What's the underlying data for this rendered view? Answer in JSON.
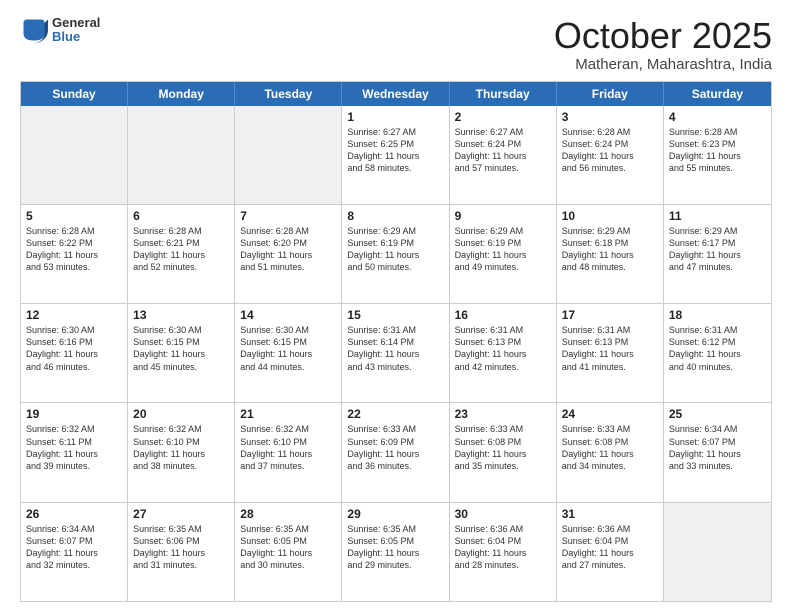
{
  "header": {
    "logo_general": "General",
    "logo_blue": "Blue",
    "month_title": "October 2025",
    "location": "Matheran, Maharashtra, India"
  },
  "weekdays": [
    "Sunday",
    "Monday",
    "Tuesday",
    "Wednesday",
    "Thursday",
    "Friday",
    "Saturday"
  ],
  "rows": [
    [
      {
        "day": "",
        "info": "",
        "shaded": true
      },
      {
        "day": "",
        "info": "",
        "shaded": true
      },
      {
        "day": "",
        "info": "",
        "shaded": true
      },
      {
        "day": "1",
        "info": "Sunrise: 6:27 AM\nSunset: 6:25 PM\nDaylight: 11 hours\nand 58 minutes."
      },
      {
        "day": "2",
        "info": "Sunrise: 6:27 AM\nSunset: 6:24 PM\nDaylight: 11 hours\nand 57 minutes."
      },
      {
        "day": "3",
        "info": "Sunrise: 6:28 AM\nSunset: 6:24 PM\nDaylight: 11 hours\nand 56 minutes."
      },
      {
        "day": "4",
        "info": "Sunrise: 6:28 AM\nSunset: 6:23 PM\nDaylight: 11 hours\nand 55 minutes."
      }
    ],
    [
      {
        "day": "5",
        "info": "Sunrise: 6:28 AM\nSunset: 6:22 PM\nDaylight: 11 hours\nand 53 minutes."
      },
      {
        "day": "6",
        "info": "Sunrise: 6:28 AM\nSunset: 6:21 PM\nDaylight: 11 hours\nand 52 minutes."
      },
      {
        "day": "7",
        "info": "Sunrise: 6:28 AM\nSunset: 6:20 PM\nDaylight: 11 hours\nand 51 minutes."
      },
      {
        "day": "8",
        "info": "Sunrise: 6:29 AM\nSunset: 6:19 PM\nDaylight: 11 hours\nand 50 minutes."
      },
      {
        "day": "9",
        "info": "Sunrise: 6:29 AM\nSunset: 6:19 PM\nDaylight: 11 hours\nand 49 minutes."
      },
      {
        "day": "10",
        "info": "Sunrise: 6:29 AM\nSunset: 6:18 PM\nDaylight: 11 hours\nand 48 minutes."
      },
      {
        "day": "11",
        "info": "Sunrise: 6:29 AM\nSunset: 6:17 PM\nDaylight: 11 hours\nand 47 minutes."
      }
    ],
    [
      {
        "day": "12",
        "info": "Sunrise: 6:30 AM\nSunset: 6:16 PM\nDaylight: 11 hours\nand 46 minutes."
      },
      {
        "day": "13",
        "info": "Sunrise: 6:30 AM\nSunset: 6:15 PM\nDaylight: 11 hours\nand 45 minutes."
      },
      {
        "day": "14",
        "info": "Sunrise: 6:30 AM\nSunset: 6:15 PM\nDaylight: 11 hours\nand 44 minutes."
      },
      {
        "day": "15",
        "info": "Sunrise: 6:31 AM\nSunset: 6:14 PM\nDaylight: 11 hours\nand 43 minutes."
      },
      {
        "day": "16",
        "info": "Sunrise: 6:31 AM\nSunset: 6:13 PM\nDaylight: 11 hours\nand 42 minutes."
      },
      {
        "day": "17",
        "info": "Sunrise: 6:31 AM\nSunset: 6:13 PM\nDaylight: 11 hours\nand 41 minutes."
      },
      {
        "day": "18",
        "info": "Sunrise: 6:31 AM\nSunset: 6:12 PM\nDaylight: 11 hours\nand 40 minutes."
      }
    ],
    [
      {
        "day": "19",
        "info": "Sunrise: 6:32 AM\nSunset: 6:11 PM\nDaylight: 11 hours\nand 39 minutes."
      },
      {
        "day": "20",
        "info": "Sunrise: 6:32 AM\nSunset: 6:10 PM\nDaylight: 11 hours\nand 38 minutes."
      },
      {
        "day": "21",
        "info": "Sunrise: 6:32 AM\nSunset: 6:10 PM\nDaylight: 11 hours\nand 37 minutes."
      },
      {
        "day": "22",
        "info": "Sunrise: 6:33 AM\nSunset: 6:09 PM\nDaylight: 11 hours\nand 36 minutes."
      },
      {
        "day": "23",
        "info": "Sunrise: 6:33 AM\nSunset: 6:08 PM\nDaylight: 11 hours\nand 35 minutes."
      },
      {
        "day": "24",
        "info": "Sunrise: 6:33 AM\nSunset: 6:08 PM\nDaylight: 11 hours\nand 34 minutes."
      },
      {
        "day": "25",
        "info": "Sunrise: 6:34 AM\nSunset: 6:07 PM\nDaylight: 11 hours\nand 33 minutes."
      }
    ],
    [
      {
        "day": "26",
        "info": "Sunrise: 6:34 AM\nSunset: 6:07 PM\nDaylight: 11 hours\nand 32 minutes."
      },
      {
        "day": "27",
        "info": "Sunrise: 6:35 AM\nSunset: 6:06 PM\nDaylight: 11 hours\nand 31 minutes."
      },
      {
        "day": "28",
        "info": "Sunrise: 6:35 AM\nSunset: 6:05 PM\nDaylight: 11 hours\nand 30 minutes."
      },
      {
        "day": "29",
        "info": "Sunrise: 6:35 AM\nSunset: 6:05 PM\nDaylight: 11 hours\nand 29 minutes."
      },
      {
        "day": "30",
        "info": "Sunrise: 6:36 AM\nSunset: 6:04 PM\nDaylight: 11 hours\nand 28 minutes."
      },
      {
        "day": "31",
        "info": "Sunrise: 6:36 AM\nSunset: 6:04 PM\nDaylight: 11 hours\nand 27 minutes."
      },
      {
        "day": "",
        "info": "",
        "shaded": true
      }
    ]
  ]
}
